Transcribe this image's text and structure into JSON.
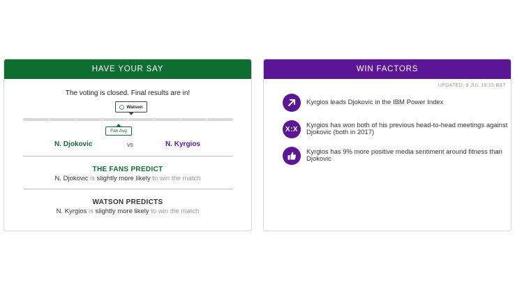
{
  "left_panel": {
    "header": "HAVE YOUR SAY",
    "closed_text": "The voting is closed. Final results are in!",
    "watson_marker": "Watson",
    "fan_marker": "Fan Avg",
    "player1": "N. Djokovic",
    "vs": "vs",
    "player2": "N. Kyrgios",
    "fans_predict": {
      "title": "THE FANS PREDICT",
      "player": "N. Djokovic",
      "is": " is ",
      "likelihood": "slightly more likely",
      "rest": " to win the match"
    },
    "watson_predicts": {
      "title": "WATSON PREDICTS",
      "player": "N. Kyrgios",
      "is": " is ",
      "likelihood": "slightly more likely",
      "rest": " to win the match"
    }
  },
  "right_panel": {
    "header": "WIN FACTORS",
    "updated": "UPDATED: 9 JUL 18:15 BST",
    "factors": [
      {
        "icon": "arrow-up-right-icon",
        "text": "Kyrgios leads Djokovic in the IBM Power Index"
      },
      {
        "icon": "head-to-head-icon",
        "icon_label": "X:X",
        "text": "Kyrgios has won both of his previous head-to-head meetings against Djokovic (both in 2017)"
      },
      {
        "icon": "thumbs-up-icon",
        "text": "Kyrgios has 9% more positive media sentiment around fitness than Djokovic"
      }
    ]
  },
  "colors": {
    "green": "#0e6e32",
    "purple": "#5a1694"
  }
}
